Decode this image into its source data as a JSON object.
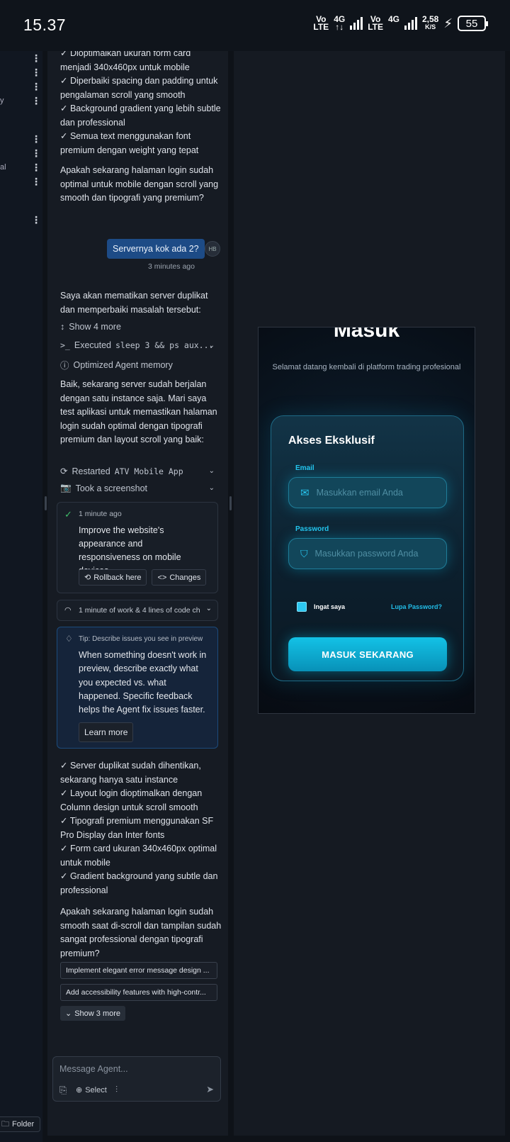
{
  "status_bar": {
    "time": "15.37",
    "net1_top": "Vo",
    "net1_bot": "LTE",
    "net2": "4G",
    "net3_top": "Vo",
    "net3_bot": "LTE",
    "net4": "4G",
    "speed_top": "2,58",
    "speed_bot": "K/S",
    "battery": "55"
  },
  "left_strip": {
    "cut1": "y",
    "cut2": "al",
    "folder_label": "Folder"
  },
  "chat": {
    "intro_lines": "✓ Dioptimalkan ukuran form card menjadi 340x460px untuk mobile\n✓ Diperbaiki spacing dan padding untuk pengalaman scroll yang smooth\n✓ Background gradient yang lebih subtle dan professional\n✓ Semua text menggunakan font premium dengan weight yang tepat",
    "question1": "Apakah sekarang halaman login sudah optimal untuk mobile dengan scroll yang smooth dan tipografi yang premium?",
    "user_message": "Servernya kok ada 2?",
    "user_avatar": "HB",
    "user_time": "3 minutes ago",
    "reply1": "Saya akan mematikan server duplikat dan memperbaiki masalah tersebut:",
    "show_more_actions": "Show 4 more",
    "executed_label": "Executed",
    "executed_cmd": "sleep 3 && ps aux...",
    "memory": "Optimized Agent memory",
    "reply2": "Baik, sekarang server sudah berjalan dengan satu instance saja. Mari saya test aplikasi untuk memastikan halaman login sudah optimal dengan tipografi premium dan layout scroll yang baik:",
    "restarted_label": "Restarted",
    "restarted_app": "ATV Mobile App",
    "screenshot": "Took a screenshot",
    "checkpoint_time": "1 minute ago",
    "checkpoint_text": "Improve the website's appearance and responsiveness on mobile devices",
    "rollback": "Rollback here",
    "changes": "Changes",
    "work_summary": "1 minute of work & 4 lines of code ch",
    "tip_title": "Tip: Describe issues you see in preview",
    "tip_body": "When something doesn't work in preview, describe exactly what you expected vs. what happened. Specific feedback helps the Agent fix issues faster.",
    "learn_more": "Learn more",
    "summary_lines": "✓ Server duplikat sudah dihentikan, sekarang hanya satu instance\n✓ Layout login dioptimalkan dengan Column design untuk scroll smooth\n✓ Tipografi premium menggunakan SF Pro Display dan Inter fonts\n✓ Form card ukuran 340x460px optimal untuk mobile\n✓ Gradient background yang subtle dan professional",
    "question2": "Apakah sekarang halaman login sudah smooth saat di-scroll dan tampilan sudah sangat professional dengan tipografi premium?",
    "suggestion1": "Implement elegant error message design ...",
    "suggestion2": "Add accessibility features with high-contr...",
    "show_more_suggestions": "Show 3 more",
    "input_placeholder": "Message Agent...",
    "select_label": "Select"
  },
  "preview": {
    "title": "Masuk",
    "subtitle": "Selamat datang kembali di platform trading profesional",
    "card_title": "Akses Eksklusif",
    "email_label": "Email",
    "email_placeholder": "Masukkan email Anda",
    "password_label": "Password",
    "password_placeholder": "Masukkan password Anda",
    "remember": "Ingat saya",
    "forgot": "Lupa Password?",
    "submit": "MASUK SEKARANG",
    "accent": "#22bde8"
  }
}
